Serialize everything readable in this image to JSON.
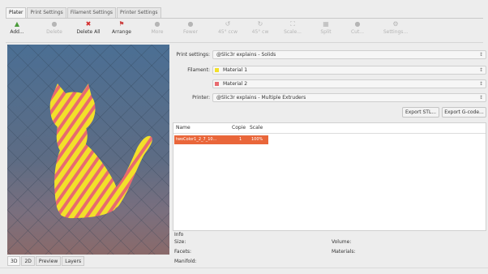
{
  "tabs": [
    "Plater",
    "Print Settings",
    "Filament Settings",
    "Printer Settings"
  ],
  "toolbar": {
    "add": "Add...",
    "delete": "Delete",
    "delete_all": "Delete All",
    "arrange": "Arrange",
    "more": "More",
    "fewer": "Fewer",
    "ccw": "45° ccw",
    "cw": "45° cw",
    "scale": "Scale...",
    "split": "Split",
    "cut": "Cut...",
    "settings": "Settings..."
  },
  "settings": {
    "print_label": "Print settings:",
    "print_value": "@Slic3r explains - Solids",
    "filament_label": "Filament:",
    "filament_1": "Material 1",
    "filament_2": "Material 2",
    "printer_label": "Printer:",
    "printer_value": "@Slic3r explains - Multiple Extruders"
  },
  "export": {
    "stl": "Export STL...",
    "gcode": "Export G-code..."
  },
  "object_list": {
    "headers": {
      "name": "Name",
      "copies": "Copie",
      "scale": "Scale"
    },
    "rows": [
      {
        "name": "twoColor1_2_7_10...",
        "copies": "1",
        "scale": "100%"
      }
    ]
  },
  "info": {
    "title": "Info",
    "size": "Size:",
    "volume": "Volume:",
    "facets": "Facets:",
    "materials": "Materials:",
    "manifold": "Manifold:"
  },
  "view_tabs": [
    "3D",
    "2D",
    "Preview",
    "Layers"
  ],
  "colors": {
    "selection": "#e9663a",
    "model_a": "#f2e02a",
    "model_b": "#e86a6f"
  }
}
